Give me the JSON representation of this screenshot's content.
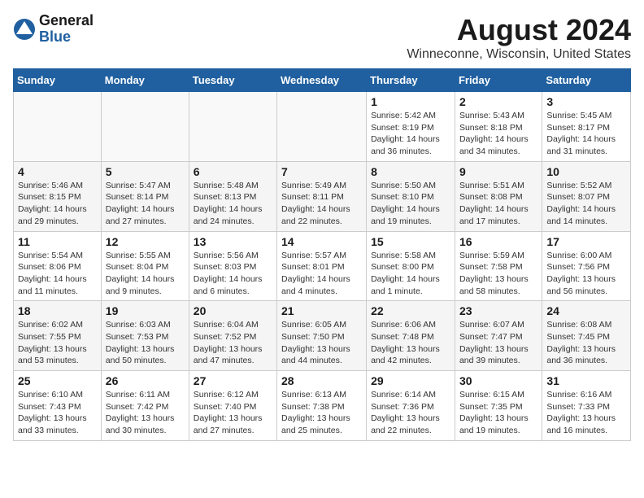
{
  "header": {
    "logo_general": "General",
    "logo_blue": "Blue",
    "month_year": "August 2024",
    "location": "Winneconne, Wisconsin, United States"
  },
  "calendar": {
    "days_of_week": [
      "Sunday",
      "Monday",
      "Tuesday",
      "Wednesday",
      "Thursday",
      "Friday",
      "Saturday"
    ],
    "weeks": [
      [
        {
          "day": "",
          "info": ""
        },
        {
          "day": "",
          "info": ""
        },
        {
          "day": "",
          "info": ""
        },
        {
          "day": "",
          "info": ""
        },
        {
          "day": "1",
          "info": "Sunrise: 5:42 AM\nSunset: 8:19 PM\nDaylight: 14 hours\nand 36 minutes."
        },
        {
          "day": "2",
          "info": "Sunrise: 5:43 AM\nSunset: 8:18 PM\nDaylight: 14 hours\nand 34 minutes."
        },
        {
          "day": "3",
          "info": "Sunrise: 5:45 AM\nSunset: 8:17 PM\nDaylight: 14 hours\nand 31 minutes."
        }
      ],
      [
        {
          "day": "4",
          "info": "Sunrise: 5:46 AM\nSunset: 8:15 PM\nDaylight: 14 hours\nand 29 minutes."
        },
        {
          "day": "5",
          "info": "Sunrise: 5:47 AM\nSunset: 8:14 PM\nDaylight: 14 hours\nand 27 minutes."
        },
        {
          "day": "6",
          "info": "Sunrise: 5:48 AM\nSunset: 8:13 PM\nDaylight: 14 hours\nand 24 minutes."
        },
        {
          "day": "7",
          "info": "Sunrise: 5:49 AM\nSunset: 8:11 PM\nDaylight: 14 hours\nand 22 minutes."
        },
        {
          "day": "8",
          "info": "Sunrise: 5:50 AM\nSunset: 8:10 PM\nDaylight: 14 hours\nand 19 minutes."
        },
        {
          "day": "9",
          "info": "Sunrise: 5:51 AM\nSunset: 8:08 PM\nDaylight: 14 hours\nand 17 minutes."
        },
        {
          "day": "10",
          "info": "Sunrise: 5:52 AM\nSunset: 8:07 PM\nDaylight: 14 hours\nand 14 minutes."
        }
      ],
      [
        {
          "day": "11",
          "info": "Sunrise: 5:54 AM\nSunset: 8:06 PM\nDaylight: 14 hours\nand 11 minutes."
        },
        {
          "day": "12",
          "info": "Sunrise: 5:55 AM\nSunset: 8:04 PM\nDaylight: 14 hours\nand 9 minutes."
        },
        {
          "day": "13",
          "info": "Sunrise: 5:56 AM\nSunset: 8:03 PM\nDaylight: 14 hours\nand 6 minutes."
        },
        {
          "day": "14",
          "info": "Sunrise: 5:57 AM\nSunset: 8:01 PM\nDaylight: 14 hours\nand 4 minutes."
        },
        {
          "day": "15",
          "info": "Sunrise: 5:58 AM\nSunset: 8:00 PM\nDaylight: 14 hours\nand 1 minute."
        },
        {
          "day": "16",
          "info": "Sunrise: 5:59 AM\nSunset: 7:58 PM\nDaylight: 13 hours\nand 58 minutes."
        },
        {
          "day": "17",
          "info": "Sunrise: 6:00 AM\nSunset: 7:56 PM\nDaylight: 13 hours\nand 56 minutes."
        }
      ],
      [
        {
          "day": "18",
          "info": "Sunrise: 6:02 AM\nSunset: 7:55 PM\nDaylight: 13 hours\nand 53 minutes."
        },
        {
          "day": "19",
          "info": "Sunrise: 6:03 AM\nSunset: 7:53 PM\nDaylight: 13 hours\nand 50 minutes."
        },
        {
          "day": "20",
          "info": "Sunrise: 6:04 AM\nSunset: 7:52 PM\nDaylight: 13 hours\nand 47 minutes."
        },
        {
          "day": "21",
          "info": "Sunrise: 6:05 AM\nSunset: 7:50 PM\nDaylight: 13 hours\nand 44 minutes."
        },
        {
          "day": "22",
          "info": "Sunrise: 6:06 AM\nSunset: 7:48 PM\nDaylight: 13 hours\nand 42 minutes."
        },
        {
          "day": "23",
          "info": "Sunrise: 6:07 AM\nSunset: 7:47 PM\nDaylight: 13 hours\nand 39 minutes."
        },
        {
          "day": "24",
          "info": "Sunrise: 6:08 AM\nSunset: 7:45 PM\nDaylight: 13 hours\nand 36 minutes."
        }
      ],
      [
        {
          "day": "25",
          "info": "Sunrise: 6:10 AM\nSunset: 7:43 PM\nDaylight: 13 hours\nand 33 minutes."
        },
        {
          "day": "26",
          "info": "Sunrise: 6:11 AM\nSunset: 7:42 PM\nDaylight: 13 hours\nand 30 minutes."
        },
        {
          "day": "27",
          "info": "Sunrise: 6:12 AM\nSunset: 7:40 PM\nDaylight: 13 hours\nand 27 minutes."
        },
        {
          "day": "28",
          "info": "Sunrise: 6:13 AM\nSunset: 7:38 PM\nDaylight: 13 hours\nand 25 minutes."
        },
        {
          "day": "29",
          "info": "Sunrise: 6:14 AM\nSunset: 7:36 PM\nDaylight: 13 hours\nand 22 minutes."
        },
        {
          "day": "30",
          "info": "Sunrise: 6:15 AM\nSunset: 7:35 PM\nDaylight: 13 hours\nand 19 minutes."
        },
        {
          "day": "31",
          "info": "Sunrise: 6:16 AM\nSunset: 7:33 PM\nDaylight: 13 hours\nand 16 minutes."
        }
      ]
    ]
  }
}
